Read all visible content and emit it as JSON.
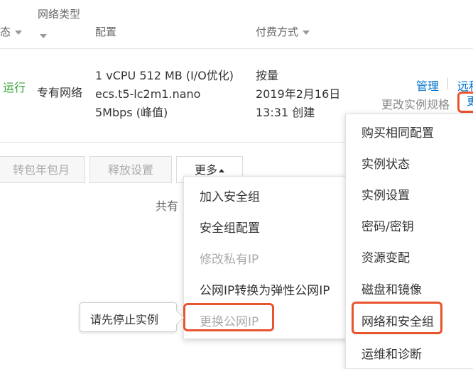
{
  "table_header": {
    "status_label": "态",
    "network_type_label": "网络类型",
    "config_label": "配置",
    "billing_label": "付费方式"
  },
  "instance_row": {
    "status": "运行",
    "network": "专有网络",
    "config_line1": "1 vCPU 512 MB (I/O优化)",
    "config_line2": "ecs.t5-lc2m1.nano",
    "config_line3": "5Mbps (峰值)",
    "billing_line1": "按量",
    "billing_line2": "2019年2月16日",
    "billing_line3": "13:31 创建",
    "action_manage": "管理",
    "action_remote": "远程",
    "action_change_spec": "更改实例规格",
    "action_more_initial": "更"
  },
  "bottom_buttons": {
    "convert_label": "转包年包月",
    "release_label": "释放设置",
    "more_label": "更多"
  },
  "footer_text_partial": "共有",
  "more_menu": {
    "items": [
      {
        "label": "加入安全组",
        "disabled": false
      },
      {
        "label": "安全组配置",
        "disabled": false
      },
      {
        "label": "修改私有IP",
        "disabled": true
      },
      {
        "label": "公网IP转换为弹性公网IP",
        "disabled": false
      },
      {
        "label": "更换公网IP",
        "disabled": true
      }
    ]
  },
  "right_menu": {
    "items": [
      {
        "label": "购买相同配置"
      },
      {
        "label": "实例状态"
      },
      {
        "label": "实例设置"
      },
      {
        "label": "密码/密钥"
      },
      {
        "label": "资源变配"
      },
      {
        "label": "磁盘和镜像"
      },
      {
        "label": "网络和安全组"
      },
      {
        "label": "运维和诊断"
      }
    ]
  },
  "tooltip_text": "请先停止实例",
  "colors": {
    "running_status": "#3aa53a",
    "link": "#0070cc",
    "highlight": "#e8542e",
    "disabled_text": "#aaaaaa"
  }
}
